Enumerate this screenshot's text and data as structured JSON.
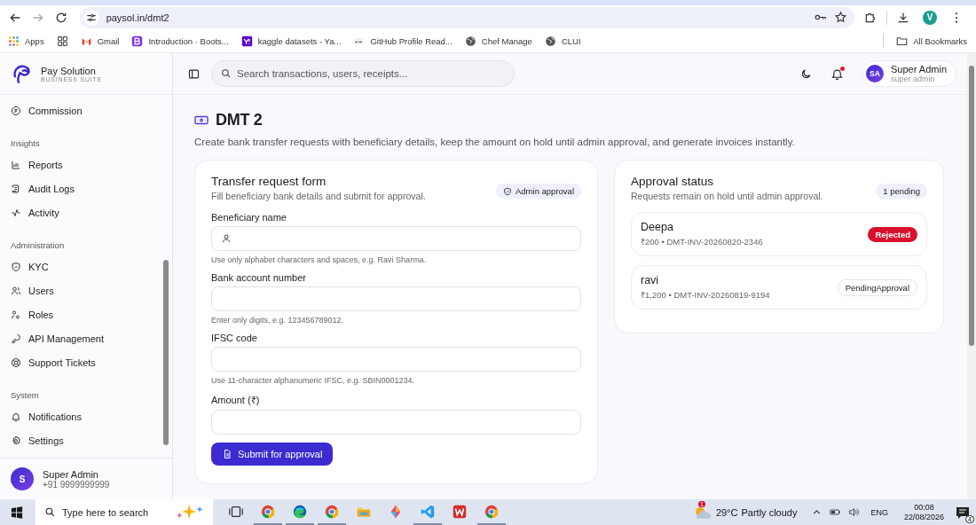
{
  "browser": {
    "nav": [
      {
        "kind": "back",
        "disabled": false
      },
      {
        "kind": "forward",
        "disabled": true
      },
      {
        "kind": "reload",
        "disabled": false
      }
    ],
    "address": "paysol.in/dmt2",
    "profile_initial": "V",
    "bookmarks": [
      {
        "kind": "apps",
        "label": "Apps"
      },
      {
        "kind": "grid"
      },
      {
        "kind": "gmail",
        "label": "Gmail"
      },
      {
        "kind": "bootstrap",
        "label": "Introduction · Boots..."
      },
      {
        "kind": "yahoo",
        "label": "kaggle datasets - Ya..."
      },
      {
        "kind": "readme",
        "label": "GitHub Profile Read..."
      },
      {
        "kind": "globe",
        "label": "Chef Manage"
      },
      {
        "kind": "globe",
        "label": "CLUI"
      }
    ],
    "all_bookmarks": "All Bookmarks"
  },
  "brand": {
    "name": "Pay Solution",
    "tagline": "BUSINESS SUITE"
  },
  "sidebar": {
    "sections": [
      {
        "items": [
          {
            "label": "Commission",
            "selected": false
          }
        ]
      },
      {
        "title": "Insights",
        "items": [
          {
            "label": "Reports",
            "selected": false
          },
          {
            "label": "Audit Logs",
            "selected": false
          },
          {
            "label": "Activity",
            "selected": false
          }
        ]
      },
      {
        "title": "Administration",
        "items": [
          {
            "label": "KYC",
            "selected": false
          },
          {
            "label": "Users",
            "selected": false
          },
          {
            "label": "Roles",
            "selected": false
          },
          {
            "label": "API Management",
            "selected": false
          },
          {
            "label": "Support Tickets",
            "selected": false
          }
        ]
      },
      {
        "title": "System",
        "items": [
          {
            "label": "Notifications",
            "selected": false
          },
          {
            "label": "Settings",
            "selected": false
          }
        ]
      }
    ],
    "user": {
      "initial": "S",
      "name": "Super Admin",
      "phone": "+91 9999999999"
    }
  },
  "topbar": {
    "search_placeholder": "Search transactions, users, receipts...",
    "unread_notifications": true,
    "user": {
      "initials": "SA",
      "name": "Super Admin",
      "role": "super admin"
    }
  },
  "page": {
    "title": "DMT 2",
    "description": "Create bank transfer requests with beneficiary details, keep the amount on hold until admin approval, and generate invoices instantly."
  },
  "form": {
    "title": "Transfer request form",
    "subtitle": "Fill beneficiary bank details and submit for approval.",
    "badge": "Admin approval",
    "fields": [
      {
        "label": "Beneficiary name",
        "hint": "Use only alphabet characters and spaces, e.g. Ravi Sharma."
      },
      {
        "label": "Bank account number",
        "hint": "Enter only digits, e.g. 123456789012."
      },
      {
        "label": "IFSC code",
        "hint": "Use 11-character alphanumeric IFSC, e.g. SBIN0001234."
      },
      {
        "label": "Amount (₹)"
      }
    ],
    "submit": "Submit for approval"
  },
  "approvals": {
    "title": "Approval status",
    "subtitle": "Requests remain on hold until admin approval.",
    "badge": "1 pending",
    "requests": [
      {
        "name": "Deepa",
        "detail": "₹200 • DMT-INV-20260820-2346",
        "status": "Rejected",
        "kind": "rejected"
      },
      {
        "name": "ravi",
        "detail": "₹1,200 • DMT-INV-20260819-9194",
        "status": "PendingApproval",
        "kind": "pending"
      }
    ]
  },
  "taskbar": {
    "search_placeholder": "Type here to search",
    "apps": [
      {
        "kind": "taskview",
        "running": false
      },
      {
        "kind": "chrome",
        "running": true
      },
      {
        "kind": "edge",
        "running": true
      },
      {
        "kind": "chrome",
        "running": true
      },
      {
        "kind": "folder",
        "running": false
      },
      {
        "kind": "kite",
        "running": false
      },
      {
        "kind": "vscode",
        "running": true
      },
      {
        "kind": "wps",
        "running": false
      },
      {
        "kind": "chrome",
        "running": true
      }
    ],
    "weather": {
      "badge": "1",
      "temperature": "29°C",
      "condition": "Partly cloudy"
    },
    "language": "ENG",
    "time": "00:08",
    "date": "22/08/2026",
    "notification_count": "4"
  }
}
